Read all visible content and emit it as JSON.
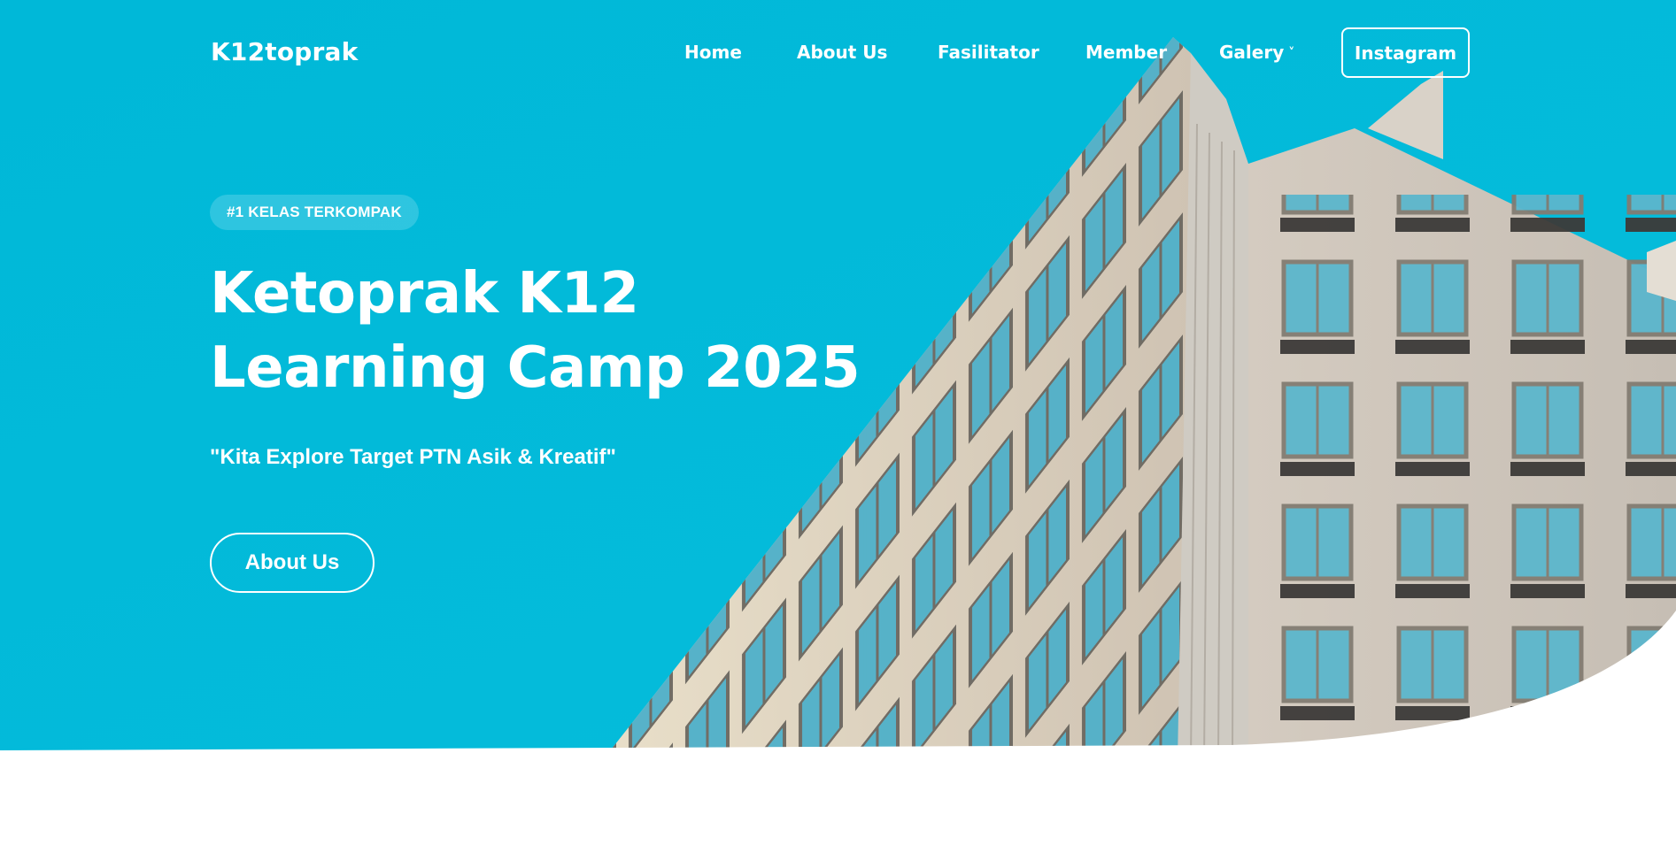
{
  "header": {
    "brand": "K12toprak",
    "nav": [
      {
        "label": "Home"
      },
      {
        "label": "About Us"
      },
      {
        "label": "Fasilitator"
      },
      {
        "label": "Member"
      },
      {
        "label": "Galery",
        "icon": "chevron-down-icon"
      }
    ],
    "cta_label": "Instagram"
  },
  "hero": {
    "badge": "#1 KELAS TERKOMPAK",
    "title_line1": "Ketoprak K12",
    "title_line2": "Learning Camp 2025",
    "tagline": "\"Kita Explore Target PTN Asik & Kreatif\"",
    "button_label": "About Us"
  },
  "colors": {
    "hero_bg": "#00bad9",
    "text": "#ffffff",
    "page_bg": "#ffffff"
  }
}
